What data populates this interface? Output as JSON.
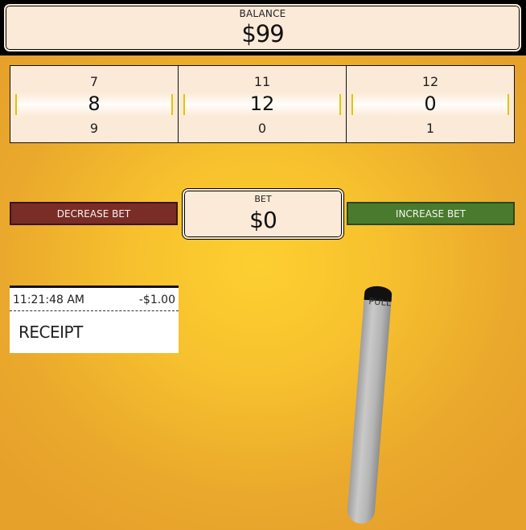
{
  "balance": {
    "label": "BALANCE",
    "value": "$99"
  },
  "reels": [
    {
      "top": "7",
      "middle": "8",
      "bottom": "9"
    },
    {
      "top": "11",
      "middle": "12",
      "bottom": "0"
    },
    {
      "top": "12",
      "middle": "0",
      "bottom": "1"
    }
  ],
  "bet": {
    "label": "BET",
    "value": "$0",
    "decrease_label": "DECREASE BET",
    "increase_label": "INCREASE BET"
  },
  "receipt": {
    "time": "11:21:48 AM",
    "amount": "-$1.00",
    "title": "RECEIPT"
  },
  "lever": {
    "label": "PULL"
  },
  "colors": {
    "panel": "#fcead8",
    "background": "#f7c22e",
    "decrease": "#7a2c26",
    "increase": "#4a7a2e",
    "marker": "#e3c400"
  }
}
